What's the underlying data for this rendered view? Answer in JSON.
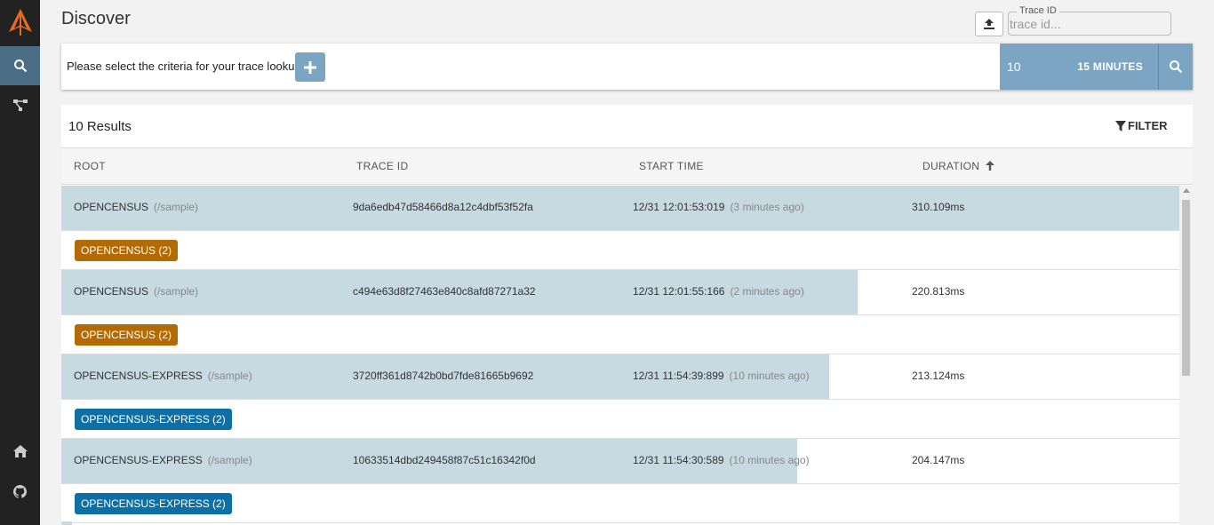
{
  "app": {
    "title": "Discover",
    "accent": "#7ba5c2",
    "sidebar_bg": "#222222",
    "sidebar_active": "#4a6e84"
  },
  "sidebar": {
    "logo": "zipkin-logo-icon",
    "items": [
      {
        "name": "search",
        "icon": "search-icon",
        "active": true
      },
      {
        "name": "dependencies",
        "icon": "dependencies-icon",
        "active": false
      },
      {
        "name": "home",
        "icon": "home-icon",
        "active": false
      },
      {
        "name": "github",
        "icon": "github-icon",
        "active": false
      }
    ]
  },
  "header": {
    "upload_icon": "upload-icon",
    "trace_id_label": "Trace ID",
    "trace_id_placeholder": "trace id..."
  },
  "criteria": {
    "prompt": "Please select the criteria for your trace lookup",
    "add_icon": "plus-icon",
    "limit": "10",
    "lookback": "15 MINUTES",
    "search_icon": "search-icon"
  },
  "results": {
    "count_label": "10 Results",
    "filter_label": "FILTER",
    "columns": {
      "root": "ROOT",
      "trace_id": "TRACE ID",
      "start_time": "START TIME",
      "duration": "DURATION",
      "sort_icon": "arrow-up-icon"
    },
    "rows": [
      {
        "service": "OPENCENSUS",
        "path": "(/sample)",
        "trace_id": "9da6edb47d58466d8a12c4dbf53f52fa",
        "start_time": "12/31 12:01:53:019",
        "ago": "(3 minutes ago)",
        "duration": "310.109ms",
        "duration_fraction": 1.0,
        "tag_label": "OPENCENSUS (2)",
        "tag_color": "#b36a00"
      },
      {
        "service": "OPENCENSUS",
        "path": "(/sample)",
        "trace_id": "c494e63d8f27463e840c8afd87271a32",
        "start_time": "12/31 12:01:55:166",
        "ago": "(2 minutes ago)",
        "duration": "220.813ms",
        "duration_fraction": 0.712,
        "tag_label": "OPENCENSUS (2)",
        "tag_color": "#b36a00"
      },
      {
        "service": "OPENCENSUS-EXPRESS",
        "path": "(/sample)",
        "trace_id": "3720ff361d8742b0bd7fde81665b9692",
        "start_time": "12/31 11:54:39:899",
        "ago": "(10 minutes ago)",
        "duration": "213.124ms",
        "duration_fraction": 0.687,
        "tag_label": "OPENCENSUS-EXPRESS (2)",
        "tag_color": "#0e6fa4"
      },
      {
        "service": "OPENCENSUS-EXPRESS",
        "path": "(/sample)",
        "trace_id": "10633514dbd249458f87c51c16342f0d",
        "start_time": "12/31 11:54:30:589",
        "ago": "(10 minutes ago)",
        "duration": "204.147ms",
        "duration_fraction": 0.658,
        "tag_label": "OPENCENSUS-EXPRESS (2)",
        "tag_color": "#0e6fa4"
      }
    ]
  }
}
